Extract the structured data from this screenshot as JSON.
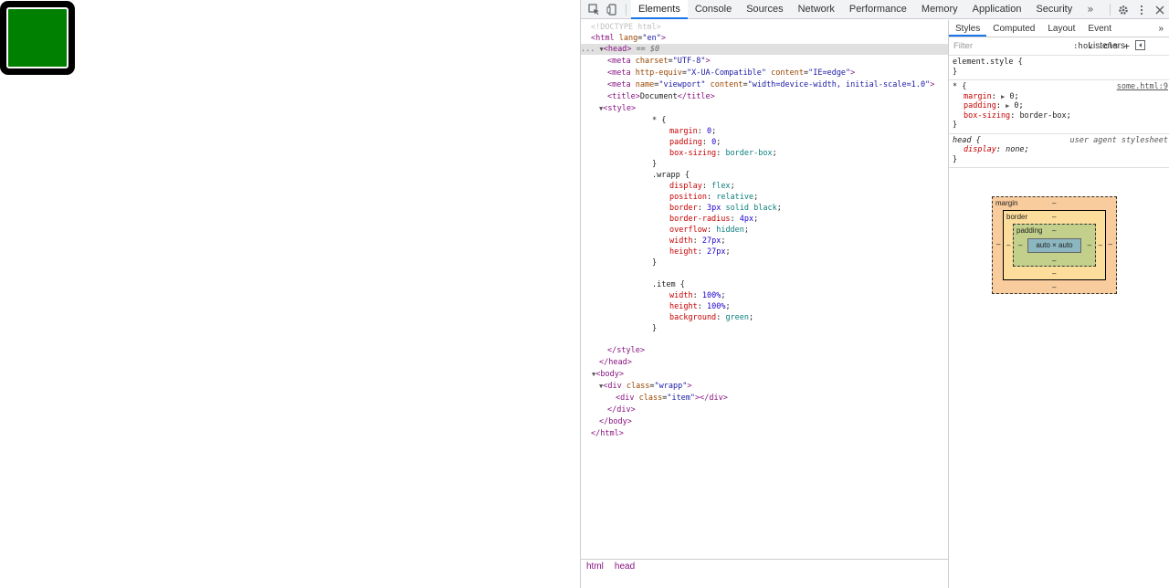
{
  "toolbar": {
    "tabs": [
      "Elements",
      "Console",
      "Sources",
      "Network",
      "Performance",
      "Memory",
      "Application",
      "Security"
    ],
    "more": "»"
  },
  "elements": {
    "doctype": "<!DOCTYPE html>",
    "html_tag": "html",
    "html_attr": "lang",
    "html_val": "\"en\"",
    "head_tag": "head",
    "head_marker": "== $0",
    "ellipsis": "...",
    "meta1_attr": "charset",
    "meta1_val": "\"UTF-8\"",
    "meta2_attr1": "http-equiv",
    "meta2_val1": "\"X-UA-Compatible\"",
    "meta2_attr2": "content",
    "meta2_val2": "\"IE=edge\"",
    "meta3_attr1": "name",
    "meta3_val1": "\"viewport\"",
    "meta3_attr2": "content",
    "meta3_val2": "\"width=device-width, initial-scale=1.0\"",
    "title_text": "Document",
    "style_tag": "style",
    "css_star": "* {",
    "css_margin_p": "margin",
    "css_margin_v": "0",
    "css_padding_p": "padding",
    "css_padding_v": "0",
    "css_boxsizing_p": "box-sizing",
    "css_boxsizing_v": "border-box",
    "close_brace": "}",
    "css_wrapp": ".wrapp {",
    "css_display_p": "display",
    "css_display_v": "flex",
    "css_position_p": "position",
    "css_position_v": "relative",
    "css_border_p": "border",
    "css_border_v1": "3px",
    "css_border_v2": "solid black",
    "css_radius_p": "border-radius",
    "css_radius_v": "4px",
    "css_overflow_p": "overflow",
    "css_overflow_v": "hidden",
    "css_width_p": "width",
    "css_width_v": "27px",
    "css_height_p": "height",
    "css_height_v": "27px",
    "css_item": ".item {",
    "css_iwidth_v": "100%",
    "css_iheight_v": "100%",
    "css_bg_p": "background",
    "css_bg_v": "green",
    "body_tag": "body",
    "div_tag": "div",
    "class_attr": "class",
    "wrapp_val": "\"wrapp\"",
    "item_val": "\"item\""
  },
  "breadcrumbs": [
    "html",
    "head"
  ],
  "styles": {
    "subtabs": [
      "Styles",
      "Computed",
      "Layout",
      "Event Listeners"
    ],
    "more": "»",
    "filter_placeholder": "Filter",
    "hov": ":hov",
    "cls": ".cls",
    "plus": "+",
    "element_style": "element.style {",
    "close": "}",
    "star_sel": "* {",
    "star_src": "some.html:9",
    "margin_p": "margin",
    "margin_v": "0",
    "padding_p": "padding",
    "padding_v": "0",
    "boxsizing_p": "box-sizing",
    "boxsizing_v": "border-box",
    "head_sel": "head {",
    "ua_label": "user agent stylesheet",
    "display_p": "display",
    "display_v": "none"
  },
  "boxmodel": {
    "margin": "margin",
    "border": "border",
    "padding": "padding",
    "content": "auto × auto",
    "dash": "–"
  },
  "colors": {
    "demo_item": "#008000",
    "accent": "#1a73e8"
  }
}
